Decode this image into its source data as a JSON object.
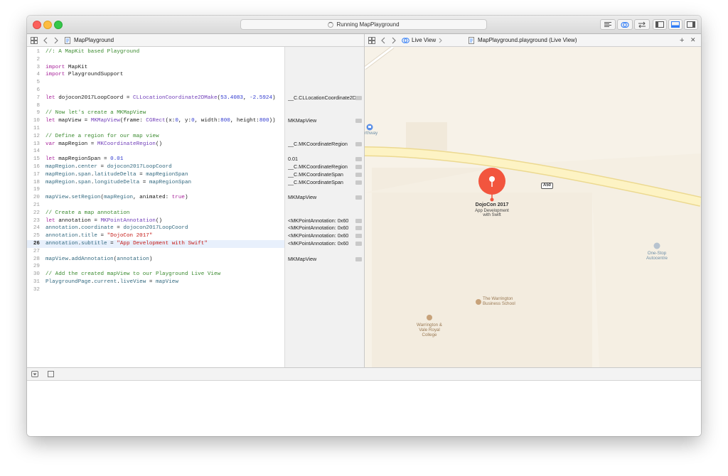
{
  "window": {
    "activity_text": "Running MapPlayground"
  },
  "editor_jumpbar": {
    "file_name": "MapPlayground"
  },
  "live_jumpbar": {
    "mode": "Live View",
    "file": "MapPlayground.playground (Live View)",
    "add_symbol": "+",
    "close_symbol": "✕"
  },
  "code_lines": [
    {
      "n": "1",
      "tokens": [
        {
          "t": "//: A MapKit based Playground",
          "c": "comment"
        }
      ]
    },
    {
      "n": "2",
      "tokens": []
    },
    {
      "n": "3",
      "tokens": [
        {
          "t": "import",
          "c": "kw"
        },
        {
          "t": " MapKit",
          "c": ""
        }
      ]
    },
    {
      "n": "4",
      "tokens": [
        {
          "t": "import",
          "c": "kw"
        },
        {
          "t": " PlaygroundSupport",
          "c": ""
        }
      ]
    },
    {
      "n": "5",
      "tokens": []
    },
    {
      "n": "6",
      "tokens": []
    },
    {
      "n": "7",
      "tokens": [
        {
          "t": "let",
          "c": "kw"
        },
        {
          "t": " dojocon2017LoopCoord = ",
          "c": ""
        },
        {
          "t": "CLLocationCoordinate2DMake",
          "c": "type"
        },
        {
          "t": "(",
          "c": ""
        },
        {
          "t": "53.4083",
          "c": "num"
        },
        {
          "t": ", ",
          "c": ""
        },
        {
          "t": "-2.5924",
          "c": "num"
        },
        {
          "t": ")",
          "c": ""
        }
      ]
    },
    {
      "n": "8",
      "tokens": []
    },
    {
      "n": "9",
      "tokens": [
        {
          "t": "// Now let's create a MKMapView",
          "c": "comment"
        }
      ]
    },
    {
      "n": "10",
      "tokens": [
        {
          "t": "let",
          "c": "kw"
        },
        {
          "t": " mapView = ",
          "c": ""
        },
        {
          "t": "MKMapView",
          "c": "type"
        },
        {
          "t": "(frame: ",
          "c": ""
        },
        {
          "t": "CGRect",
          "c": "type"
        },
        {
          "t": "(x:",
          "c": ""
        },
        {
          "t": "0",
          "c": "num"
        },
        {
          "t": ", y:",
          "c": ""
        },
        {
          "t": "0",
          "c": "num"
        },
        {
          "t": ", width:",
          "c": ""
        },
        {
          "t": "800",
          "c": "num"
        },
        {
          "t": ", height:",
          "c": ""
        },
        {
          "t": "800",
          "c": "num"
        },
        {
          "t": "))",
          "c": ""
        }
      ]
    },
    {
      "n": "11",
      "tokens": []
    },
    {
      "n": "12",
      "tokens": [
        {
          "t": "// Define a region for our map view",
          "c": "comment"
        }
      ]
    },
    {
      "n": "13",
      "tokens": [
        {
          "t": "var",
          "c": "kw"
        },
        {
          "t": " mapRegion = ",
          "c": ""
        },
        {
          "t": "MKCoordinateRegion",
          "c": "type"
        },
        {
          "t": "()",
          "c": ""
        }
      ]
    },
    {
      "n": "14",
      "tokens": []
    },
    {
      "n": "15",
      "tokens": [
        {
          "t": "let",
          "c": "kw"
        },
        {
          "t": " mapRegionSpan = ",
          "c": ""
        },
        {
          "t": "0.01",
          "c": "num"
        }
      ]
    },
    {
      "n": "16",
      "tokens": [
        {
          "t": "mapRegion",
          "c": "ident"
        },
        {
          "t": ".",
          "c": ""
        },
        {
          "t": "center",
          "c": "ident"
        },
        {
          "t": " = ",
          "c": ""
        },
        {
          "t": "dojocon2017LoopCoord",
          "c": "ident"
        }
      ]
    },
    {
      "n": "17",
      "tokens": [
        {
          "t": "mapRegion",
          "c": "ident"
        },
        {
          "t": ".",
          "c": ""
        },
        {
          "t": "span",
          "c": "ident"
        },
        {
          "t": ".",
          "c": ""
        },
        {
          "t": "latitudeDelta",
          "c": "ident"
        },
        {
          "t": " = ",
          "c": ""
        },
        {
          "t": "mapRegionSpan",
          "c": "ident"
        }
      ]
    },
    {
      "n": "18",
      "tokens": [
        {
          "t": "mapRegion",
          "c": "ident"
        },
        {
          "t": ".",
          "c": ""
        },
        {
          "t": "span",
          "c": "ident"
        },
        {
          "t": ".",
          "c": ""
        },
        {
          "t": "longitudeDelta",
          "c": "ident"
        },
        {
          "t": " = ",
          "c": ""
        },
        {
          "t": "mapRegionSpan",
          "c": "ident"
        }
      ]
    },
    {
      "n": "19",
      "tokens": []
    },
    {
      "n": "20",
      "tokens": [
        {
          "t": "mapView",
          "c": "ident"
        },
        {
          "t": ".",
          "c": ""
        },
        {
          "t": "setRegion",
          "c": "ident"
        },
        {
          "t": "(",
          "c": ""
        },
        {
          "t": "mapRegion",
          "c": "ident"
        },
        {
          "t": ", animated: ",
          "c": ""
        },
        {
          "t": "true",
          "c": "kw"
        },
        {
          "t": ")",
          "c": ""
        }
      ]
    },
    {
      "n": "21",
      "tokens": []
    },
    {
      "n": "22",
      "tokens": [
        {
          "t": "// Create a map annotation",
          "c": "comment"
        }
      ]
    },
    {
      "n": "23",
      "tokens": [
        {
          "t": "let",
          "c": "kw"
        },
        {
          "t": " annotation = ",
          "c": ""
        },
        {
          "t": "MKPointAnnotation",
          "c": "type"
        },
        {
          "t": "()",
          "c": ""
        }
      ]
    },
    {
      "n": "24",
      "tokens": [
        {
          "t": "annotation",
          "c": "ident"
        },
        {
          "t": ".",
          "c": ""
        },
        {
          "t": "coordinate",
          "c": "ident"
        },
        {
          "t": " = ",
          "c": ""
        },
        {
          "t": "dojocon2017LoopCoord",
          "c": "ident"
        }
      ]
    },
    {
      "n": "25",
      "tokens": [
        {
          "t": "annotation",
          "c": "ident"
        },
        {
          "t": ".",
          "c": ""
        },
        {
          "t": "title",
          "c": "ident"
        },
        {
          "t": " = ",
          "c": ""
        },
        {
          "t": "\"DojoCon 2017\"",
          "c": "str"
        }
      ]
    },
    {
      "n": "26",
      "tokens": [
        {
          "t": "annotation",
          "c": "ident"
        },
        {
          "t": ".",
          "c": ""
        },
        {
          "t": "subtitle",
          "c": "ident"
        },
        {
          "t": " = ",
          "c": ""
        },
        {
          "t": "\"App Development with Swift\"",
          "c": "str"
        }
      ],
      "current": true
    },
    {
      "n": "27",
      "tokens": []
    },
    {
      "n": "28",
      "tokens": [
        {
          "t": "mapView",
          "c": "ident"
        },
        {
          "t": ".",
          "c": ""
        },
        {
          "t": "addAnnotation",
          "c": "ident"
        },
        {
          "t": "(",
          "c": ""
        },
        {
          "t": "annotation",
          "c": "ident"
        },
        {
          "t": ")",
          "c": ""
        }
      ]
    },
    {
      "n": "29",
      "tokens": []
    },
    {
      "n": "30",
      "tokens": [
        {
          "t": "// Add the created mapView to our Playground Live View",
          "c": "comment"
        }
      ]
    },
    {
      "n": "31",
      "tokens": [
        {
          "t": "PlaygroundPage",
          "c": "ident"
        },
        {
          "t": ".",
          "c": ""
        },
        {
          "t": "current",
          "c": "ident"
        },
        {
          "t": ".",
          "c": ""
        },
        {
          "t": "liveView",
          "c": "ident"
        },
        {
          "t": " = ",
          "c": ""
        },
        {
          "t": "mapView",
          "c": "ident"
        }
      ]
    },
    {
      "n": "32",
      "tokens": []
    }
  ],
  "results": [
    {
      "line": 7,
      "text": "__C.CLLocationCoordinate2D"
    },
    {
      "line": 10,
      "text": "MKMapView"
    },
    {
      "line": 13,
      "text": "__C.MKCoordinateRegion"
    },
    {
      "line": 15,
      "text": "0.01"
    },
    {
      "line": 16,
      "text": "__C.MKCoordinateRegion"
    },
    {
      "line": 17,
      "text": "__C.MKCoordinateSpan"
    },
    {
      "line": 18,
      "text": "__C.MKCoordinateSpan"
    },
    {
      "line": 20,
      "text": "MKMapView"
    },
    {
      "line": 23,
      "text": "<MKPointAnnotation: 0x60"
    },
    {
      "line": 24,
      "text": "<MKPointAnnotation: 0x60"
    },
    {
      "line": 25,
      "text": "<MKPointAnnotation: 0x60"
    },
    {
      "line": 26,
      "text": "<MKPointAnnotation: 0x60"
    },
    {
      "line": 28,
      "text": "MKMapView"
    }
  ],
  "map": {
    "road_badge": "A50",
    "pin_title": "DojoCon 2017",
    "pin_subtitle_1": "App Development",
    "pin_subtitle_2": "with Swift",
    "label_rthway": "rthway",
    "label_onestop_1": "One-Stop",
    "label_onestop_2": "Autocentre",
    "label_warrington_bs_1": "The Warrington",
    "label_warrington_bs_2": "Business School",
    "label_college_1": "Warrington &",
    "label_college_2": "Vale Royal",
    "label_college_3": "College",
    "colors": {
      "pin": "#f2553e",
      "road_fill": "#fdf3c4",
      "road_edge": "#ecd990",
      "land": "#f7f2e8",
      "block": "#f1e9da"
    }
  }
}
